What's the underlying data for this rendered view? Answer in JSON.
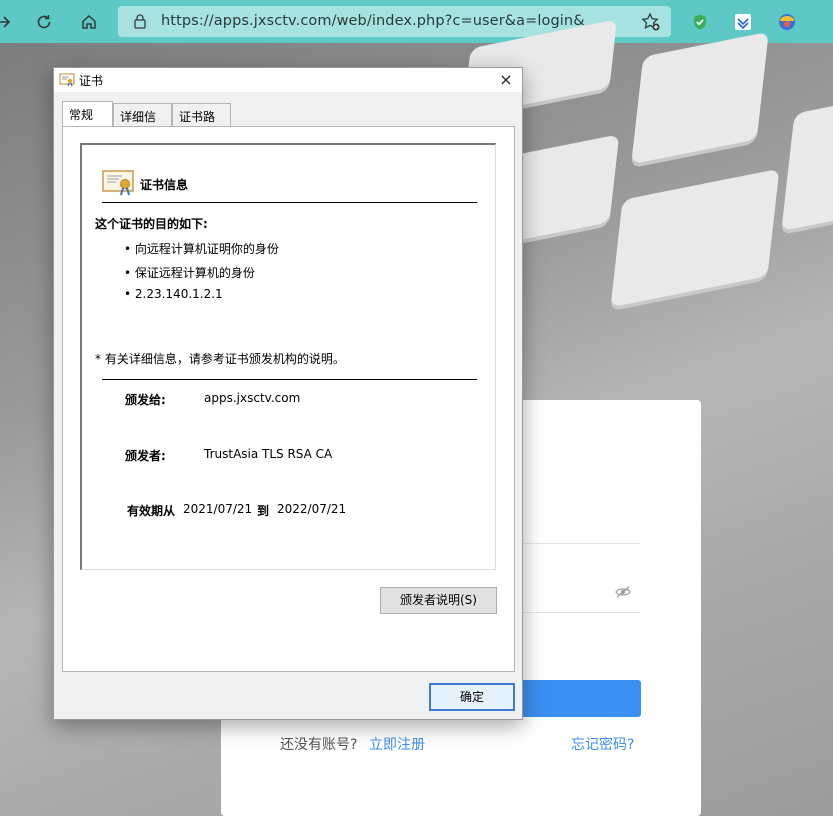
{
  "browser": {
    "url": "https://apps.jxsctv.com/web/index.php?c=user&a=login&"
  },
  "login_page": {
    "no_account": "还没有账号?",
    "register_link": "立即注册",
    "forgot_link": "忘记密码?"
  },
  "dialog": {
    "title": "证书",
    "close": "×",
    "tabs": [
      "常规",
      "详细信息",
      "证书路径"
    ],
    "info_title": "证书信息",
    "purpose_heading": "这个证书的目的如下:",
    "purposes": [
      "• 向远程计算机证明你的身份",
      "• 保证远程计算机的身份",
      "• 2.23.140.1.2.1"
    ],
    "note": "* 有关详细信息，请参考证书颁发机构的说明。",
    "issued_to_label": "颁发给:",
    "issued_to": "apps.jxsctv.com",
    "issued_by_label": "颁发者:",
    "issued_by": "TrustAsia TLS RSA CA",
    "valid_from_label": "有效期从",
    "valid_from": "2021/07/21",
    "to_label": "到",
    "valid_to": "2022/07/21",
    "issuer_statement_button": "颁发者说明(S)",
    "ok_button": "确定"
  }
}
